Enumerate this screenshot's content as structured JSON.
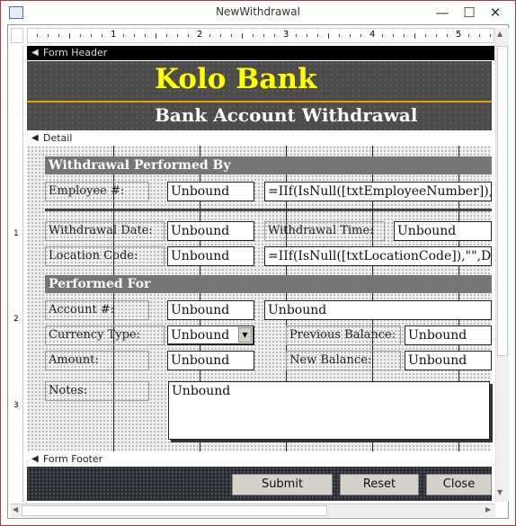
{
  "window": {
    "title": "NewWithdrawal",
    "icon": "form-icon",
    "minimize": "minimize-icon",
    "maximize": "maximize-icon",
    "close": "close-icon"
  },
  "ruler": {
    "marks": [
      "1",
      "2",
      "3",
      "4",
      "5"
    ],
    "left_marks": [
      "1",
      "2",
      "3"
    ]
  },
  "sections": {
    "header": "Form Header",
    "detail": "Detail",
    "footer": "Form Footer"
  },
  "header": {
    "bank_name": "Kolo Bank",
    "subtitle": "Bank Account Withdrawal"
  },
  "detail": {
    "performed_by": "Withdrawal Performed By",
    "employee_label": "Employee #:",
    "employee_value": "Unbound",
    "employee_expr": "=IIf(IsNull([txtEmployeeNumber]),'",
    "date_label": "Withdrawal Date:",
    "date_value": "Unbound",
    "time_label": "Withdrawal Time:",
    "time_value": "Unbound",
    "location_label": "Location Code:",
    "location_value": "Unbound",
    "location_expr": "=IIf(IsNull([txtLocationCode]),\"\",DI",
    "performed_for": "Performed For",
    "account_label": "Account #:",
    "account_value": "Unbound",
    "account_name": "Unbound",
    "currency_label": "Currency Type:",
    "currency_value": "Unbound",
    "prev_balance_label": "Previous Balance:",
    "prev_balance_value": "Unbound",
    "amount_label": "Amount:",
    "amount_value": "Unbound",
    "new_balance_label": "New Balance:",
    "new_balance_value": "Unbound",
    "notes_label": "Notes:",
    "notes_value": "Unbound"
  },
  "footer": {
    "submit": "Submit",
    "reset": "Reset",
    "close": "Close"
  },
  "colors": {
    "header_bg": "#4c4c4c",
    "bank_name": "#ffff00",
    "accent_line": "#f0a000",
    "section_head": "#767676",
    "window_border": "#b03a3a"
  }
}
